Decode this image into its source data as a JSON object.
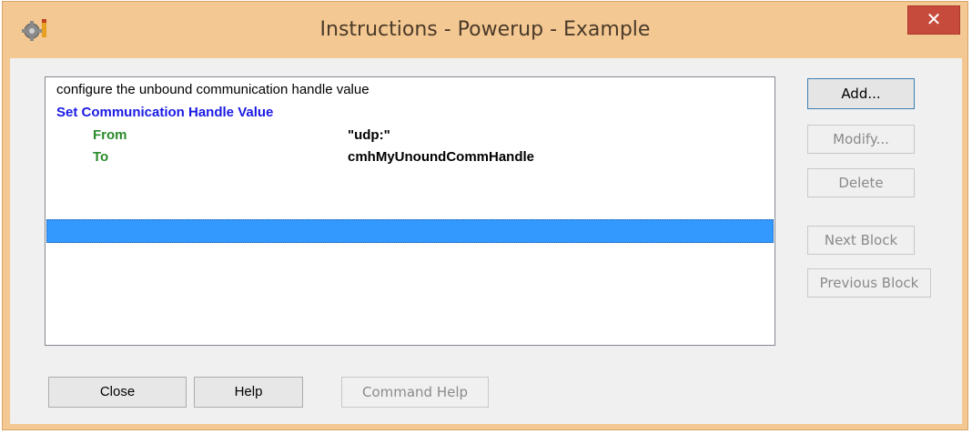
{
  "window": {
    "title": "Instructions - Powerup - Example",
    "close_glyph": "✕",
    "icon": "gear-app-icon"
  },
  "listbox": {
    "comment": "configure the unbound communication handle value",
    "command": "Set Communication Handle Value",
    "params": [
      {
        "name": "From",
        "value": "\"udp:\""
      },
      {
        "name": "To",
        "value": "cmhMyUnoundCommHandle"
      }
    ],
    "selected_row_empty": true
  },
  "side_buttons": {
    "add": "Add...",
    "modify": "Modify...",
    "delete": "Delete",
    "next_block": "Next Block",
    "previous_block": "Previous Block"
  },
  "bottom_buttons": {
    "close": "Close",
    "help": "Help",
    "command_help": "Command Help"
  },
  "colors": {
    "frame": "#f4c892",
    "close_button": "#c74b3c",
    "command_text": "#1a1ae6",
    "param_name_text": "#2a8a2a",
    "selection": "#3399ff"
  }
}
